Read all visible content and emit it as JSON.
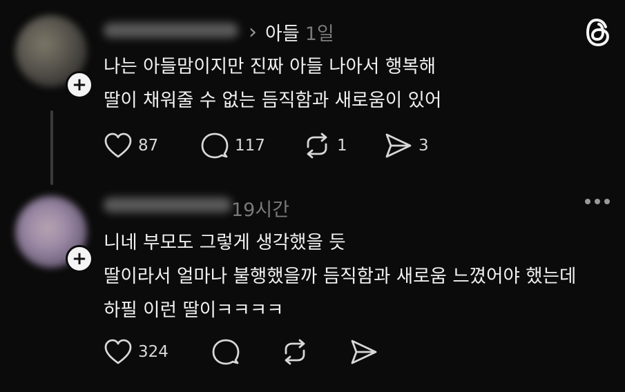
{
  "posts": [
    {
      "topic": "아들",
      "time": "1일",
      "lines": [
        "나는 아들맘이지만 진짜 아들 나아서 행복해",
        "딸이 채워줄 수 없는 듬직함과 새로움이 있어"
      ],
      "likes": "87",
      "replies": "117",
      "reposts": "1",
      "shares": "3"
    },
    {
      "time": "19시간",
      "lines": [
        "니네 부모도 그렇게 생각했을 듯",
        "딸이라서 얼마나 불행했을까 듬직함과 새로움 느꼈어야 했는데",
        "하필 이런 딸이ㅋㅋㅋㅋ"
      ],
      "likes": "324"
    }
  ],
  "icons": {
    "like": "heart-icon",
    "reply": "comment-bubble-icon",
    "repost": "repost-arrows-icon",
    "share": "send-icon",
    "logo": "threads-logo-icon",
    "more": "more-dots-icon",
    "follow": "plus-icon"
  },
  "colors": {
    "background": "#0b0b0b",
    "text": "#f2f2f2",
    "muted": "#7a7a7a"
  }
}
